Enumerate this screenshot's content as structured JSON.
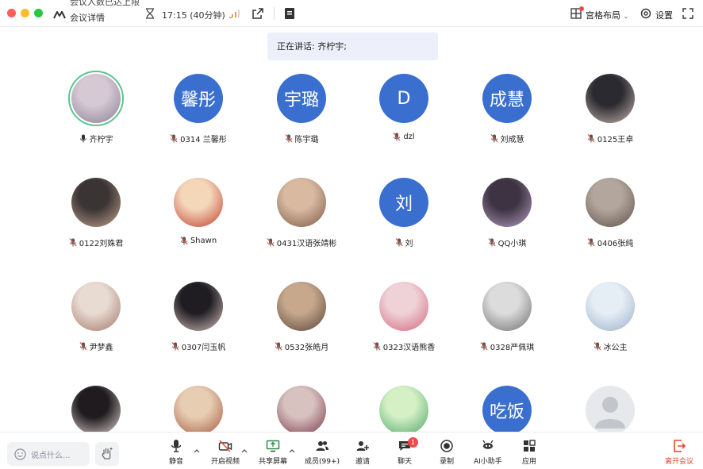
{
  "titlebar": {
    "meeting_title_cut": "会议人数已达上限",
    "meeting_detail": "会议详情",
    "timer": "17:15 (40分钟)",
    "layout_label": "宫格布局",
    "settings_label": "设置"
  },
  "speaking_banner": "正在讲话: 齐柠宇;",
  "participants": [
    {
      "name": "齐柠宇",
      "avatar": "photo",
      "mic": "active",
      "speaking": true
    },
    {
      "name": "0314 兰馨彤",
      "avatar_text": "馨彤",
      "mic": "muted"
    },
    {
      "name": "陈宇璐",
      "avatar_text": "宇璐",
      "mic": "muted"
    },
    {
      "name": "dzl",
      "avatar_text": "D",
      "mic": "muted"
    },
    {
      "name": "刘成慧",
      "avatar_text": "成慧",
      "mic": "muted"
    },
    {
      "name": "0125王卓",
      "avatar": "photo",
      "mic": "muted"
    },
    {
      "name": "0122刘姝君",
      "avatar": "photo",
      "mic": "muted"
    },
    {
      "name": "Shawn",
      "avatar": "photo",
      "mic": "muted"
    },
    {
      "name": "0431汉语张靖彬",
      "avatar": "photo",
      "mic": "muted"
    },
    {
      "name": "刘",
      "avatar_text": "刘",
      "mic": "muted"
    },
    {
      "name": "QQ小琪",
      "avatar": "photo",
      "mic": "muted"
    },
    {
      "name": "0406张纯",
      "avatar": "photo",
      "mic": "muted"
    },
    {
      "name": "尹梦鑫",
      "avatar": "photo",
      "mic": "muted"
    },
    {
      "name": "0307闫玉帆",
      "avatar": "photo",
      "mic": "muted"
    },
    {
      "name": "0532张皓月",
      "avatar": "photo",
      "mic": "muted"
    },
    {
      "name": "0323汉语熊香",
      "avatar": "photo",
      "mic": "muted"
    },
    {
      "name": "0328严佩琪",
      "avatar": "photo",
      "mic": "muted"
    },
    {
      "name": "冰公主",
      "avatar": "photo",
      "mic": "muted"
    },
    {
      "name": "",
      "avatar": "photo"
    },
    {
      "name": "",
      "avatar": "photo"
    },
    {
      "name": "",
      "avatar": "photo"
    },
    {
      "name": "",
      "avatar": "photo"
    },
    {
      "name": "",
      "avatar_text": "吃饭"
    },
    {
      "name": "",
      "avatar": "placeholder"
    }
  ],
  "toolbar": {
    "chat_placeholder": "说点什么...",
    "mute_label": "静音",
    "video_label": "开启视频",
    "share_label": "共享屏幕",
    "members_label": "成员(99+)",
    "invite_label": "邀请",
    "chat_label": "聊天",
    "chat_badge": "1",
    "record_label": "录制",
    "ai_label": "AI小助手",
    "apps_label": "应用",
    "leave_label": "离开会议"
  },
  "colors": {
    "avatar_blue": "#3a6fd0",
    "speaking_ring": "#5ac48c",
    "leave_red": "#e34a2c",
    "muted_red": "#e0533c"
  }
}
